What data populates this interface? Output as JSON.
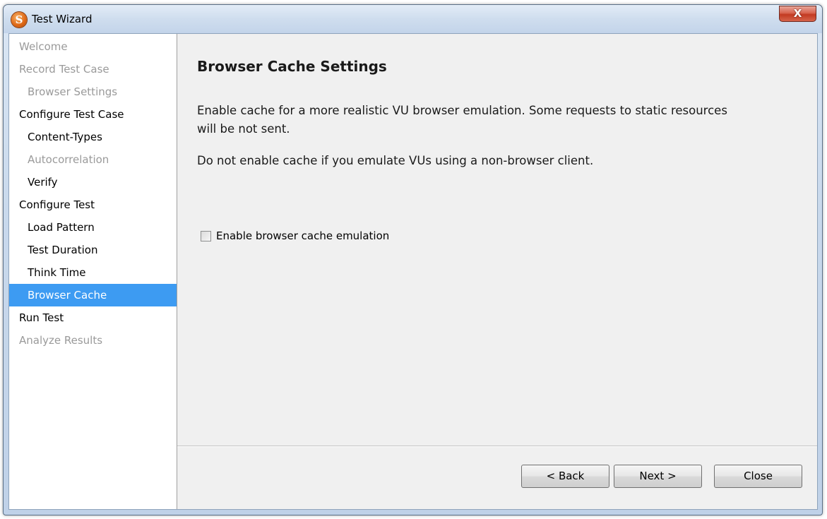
{
  "window": {
    "title": "Test Wizard",
    "app_icon_letter": "S",
    "close_glyph": "X"
  },
  "sidebar": {
    "items": [
      {
        "label": "Welcome",
        "level": 0,
        "state": "disabled"
      },
      {
        "label": "Record Test Case",
        "level": 0,
        "state": "disabled"
      },
      {
        "label": "Browser Settings",
        "level": 1,
        "state": "disabled"
      },
      {
        "label": "Configure Test Case",
        "level": 0,
        "state": "enabled"
      },
      {
        "label": "Content-Types",
        "level": 1,
        "state": "enabled"
      },
      {
        "label": "Autocorrelation",
        "level": 1,
        "state": "disabled"
      },
      {
        "label": "Verify",
        "level": 1,
        "state": "enabled"
      },
      {
        "label": "Configure Test",
        "level": 0,
        "state": "enabled"
      },
      {
        "label": "Load Pattern",
        "level": 1,
        "state": "enabled"
      },
      {
        "label": "Test Duration",
        "level": 1,
        "state": "enabled"
      },
      {
        "label": "Think Time",
        "level": 1,
        "state": "enabled"
      },
      {
        "label": "Browser Cache",
        "level": 1,
        "state": "selected"
      },
      {
        "label": "Run Test",
        "level": 0,
        "state": "enabled"
      },
      {
        "label": "Analyze Results",
        "level": 0,
        "state": "disabled"
      }
    ]
  },
  "main": {
    "heading": "Browser Cache Settings",
    "description": "Enable cache for a more realistic VU browser emulation. Some requests to static resources will be not sent.",
    "note": "Do not enable cache if you emulate VUs using a non-browser client.",
    "checkbox": {
      "label": "Enable browser cache emulation",
      "checked": false
    }
  },
  "footer": {
    "back_label": "< Back",
    "next_label": "Next >",
    "close_label": "Close"
  },
  "colors": {
    "selection": "#3d9bf2",
    "disabled_text": "#9a9a9a"
  }
}
